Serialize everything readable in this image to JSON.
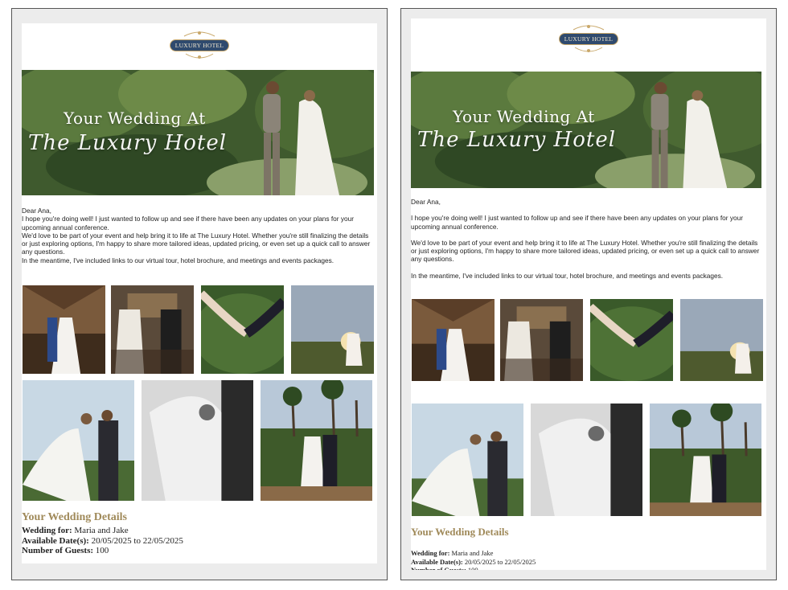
{
  "logo": {
    "text": "LUXURY HOTEL"
  },
  "banner": {
    "line1": "Your Wedding At",
    "line2": "The Luxury Hotel"
  },
  "email": {
    "greeting": "Dear Ana,",
    "paragraph1": "I hope you're doing well! I just wanted to follow up and see if there have been any updates on your plans for your upcoming annual conference.",
    "paragraph2": "We'd love to be part of your event and help bring it to life at The Luxury Hotel. Whether you're still finalizing the details or just exploring options, I'm happy to share more tailored ideas, updated pricing, or even set up a quick call to answer any questions.",
    "paragraph3": "In the meantime, I've included links to our virtual tour, hotel brochure, and meetings and events packages."
  },
  "details": {
    "title": "Your Wedding Details",
    "wedding_for_label": "Wedding for:",
    "wedding_for_value": "Maria and Jake",
    "dates_label": "Available Date(s):",
    "dates_value": "20/05/2025 to 22/05/2025",
    "guests_label": "Number of Guests:",
    "guests_value": "100"
  },
  "colors": {
    "accent_gold": "#a08a5a",
    "logo_navy": "#2f4a6e"
  }
}
